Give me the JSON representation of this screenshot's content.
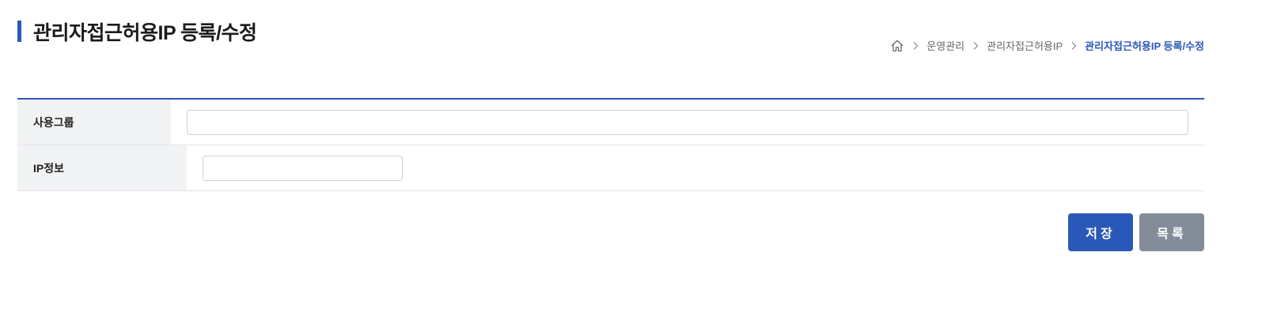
{
  "header": {
    "title": "관리자접근허용IP 등록/수정"
  },
  "breadcrumb": {
    "home_icon": "home-icon",
    "items": [
      {
        "label": "운영관리"
      },
      {
        "label": "관리자접근허용IP"
      },
      {
        "label": "관리자접근허용IP 등록/수정"
      }
    ]
  },
  "form": {
    "rows": [
      {
        "label": "사용그룹",
        "value": "",
        "placeholder": ""
      },
      {
        "label": "IP정보",
        "value": "",
        "placeholder": ""
      }
    ]
  },
  "actions": {
    "save_label": "저장",
    "list_label": "목록"
  },
  "colors": {
    "accent": "#2a58b8",
    "secondary_button": "#858c99",
    "label_background": "#f2f3f5"
  }
}
